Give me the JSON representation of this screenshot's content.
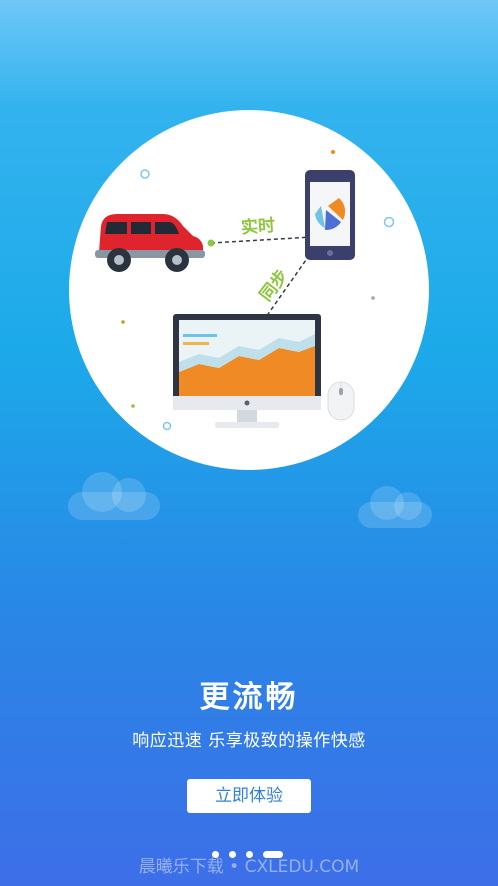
{
  "illustration": {
    "label_realtime": "实时",
    "label_sync": "同步",
    "accent_green": "#8dc63f",
    "car_color": "#e0242e"
  },
  "slide": {
    "title": "更流畅",
    "subtitle": "响应迅速 乐享极致的操作快感"
  },
  "cta": {
    "label": "立即体验"
  },
  "pager": {
    "total": 4,
    "active_index": 3
  },
  "watermark": {
    "text": "晨曦乐下载 • CXLEDU.COM"
  }
}
